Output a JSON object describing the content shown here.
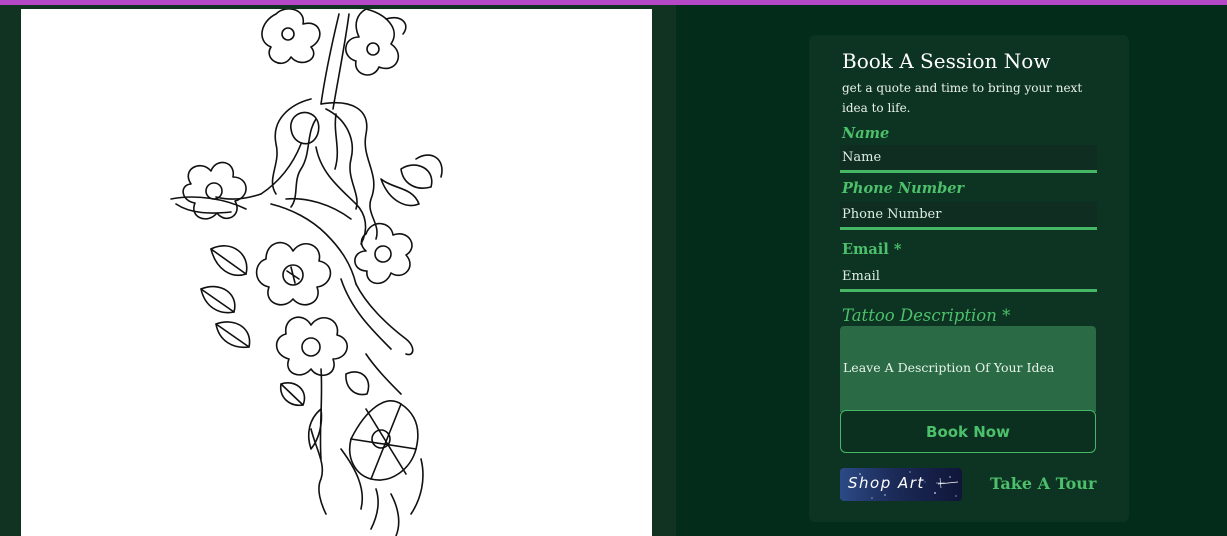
{
  "booking": {
    "title": "Book A Session Now",
    "subtitle": "get a quote and time to bring your next idea to life.",
    "fields": {
      "name": {
        "label": "Name",
        "placeholder": "Name"
      },
      "phone": {
        "label": "Phone Number",
        "placeholder": "Phone Number"
      },
      "email": {
        "label": "Email *",
        "placeholder": "Email"
      },
      "description": {
        "label": "Tattoo Description *",
        "placeholder": "Leave A Description Of Your Idea"
      }
    },
    "submit_label": "Book Now"
  },
  "links": {
    "shop_art_label": "Shop Art",
    "tour_label": "Take A Tour"
  },
  "colors": {
    "accent": "#4cc06b",
    "page_bg": "#042c1a",
    "card_bg": "#0d3322",
    "top_bar": "#b548c6"
  }
}
